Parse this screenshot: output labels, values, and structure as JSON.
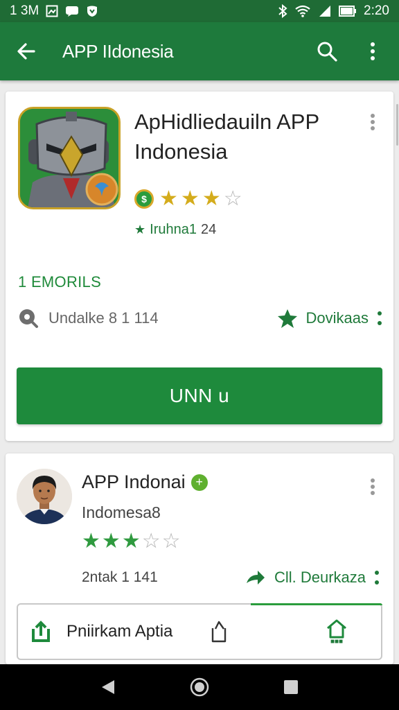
{
  "status_bar": {
    "time_left": "1 3M",
    "time_right": "2:20"
  },
  "app_bar": {
    "title": "APP IIdonesia"
  },
  "app_card": {
    "title": "ApHidliedauiln APP Indonesia",
    "sub_label": "Iruhna1",
    "sub_count": "24",
    "section_label": "1 EMORILS",
    "meta_left": "Undalke 8 1 114",
    "meta_right": "Dovikaas",
    "primary_button": "UNN u",
    "rating": 3
  },
  "developer_card": {
    "name": "APP Indonai",
    "subtitle": "Indomesa8",
    "meta_left": "2ntak 1 141",
    "meta_right": "Cll. Deurkaza",
    "panel_label": "Pniirkam Aptia",
    "rating": 3
  },
  "colors": {
    "app_bar": "#1e7a3c",
    "status_bar": "#1f6b35",
    "accent": "#1e8a3c",
    "star_gold": "#d4ac1c",
    "star_green": "#2f9a3f"
  }
}
